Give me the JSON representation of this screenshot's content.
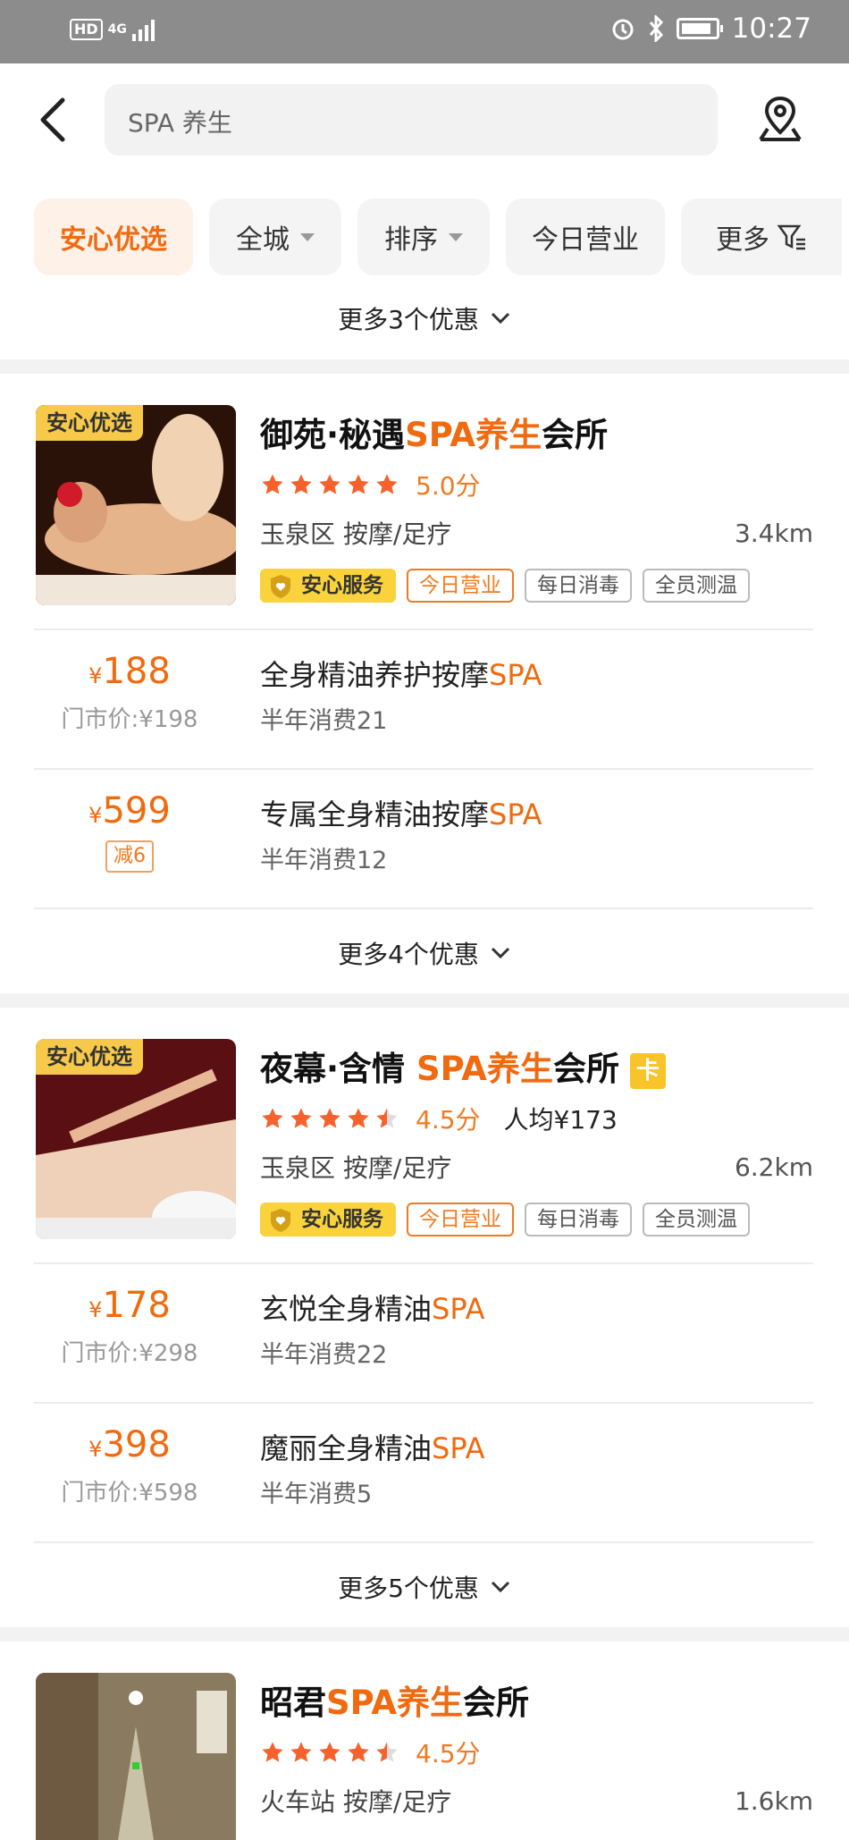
{
  "status_bar": {
    "network": "4G",
    "hd": "HD",
    "time": "10:27"
  },
  "search": {
    "value": "SPA 养生"
  },
  "filters": [
    {
      "label": "安心优选",
      "active": true
    },
    {
      "label": "全城"
    },
    {
      "label": "排序"
    },
    {
      "label": "今日营业"
    },
    {
      "label": "更多"
    }
  ],
  "more_offers_top": "更多3个优惠",
  "shops": [
    {
      "badge": "安心优选",
      "name_pre": "御苑·秘遇",
      "name_hl": "SPA养生",
      "name_post": "会所",
      "rating": 5.0,
      "score": "5.0分",
      "area": "玉泉区 按摩/足疗",
      "distance": "3.4km",
      "tags": [
        "安心服务",
        "今日营业",
        "每日消毒",
        "全员测温"
      ],
      "deals": [
        {
          "price": "188",
          "orig": "门市价:¥198",
          "title": "全身精油养护按摩",
          "title_hl": "SPA",
          "sold": "半年消费21"
        },
        {
          "price": "599",
          "minus": "减6",
          "title": "专属全身精油按摩",
          "title_hl": "SPA",
          "sold": "半年消费12"
        }
      ],
      "more": "更多4个优惠"
    },
    {
      "badge": "安心优选",
      "name_pre": "夜幕·含情 ",
      "name_hl": "SPA养生",
      "name_post": "会所",
      "card": "卡",
      "rating": 4.5,
      "score": "4.5分",
      "avg": "人均¥173",
      "area": "玉泉区 按摩/足疗",
      "distance": "6.2km",
      "tags": [
        "安心服务",
        "今日营业",
        "每日消毒",
        "全员测温"
      ],
      "deals": [
        {
          "price": "178",
          "orig": "门市价:¥298",
          "title": "玄悦全身精油",
          "title_hl": "SPA",
          "sold": "半年消费22"
        },
        {
          "price": "398",
          "orig": "门市价:¥598",
          "title": "魔丽全身精油",
          "title_hl": "SPA",
          "sold": "半年消费5"
        }
      ],
      "more": "更多5个优惠"
    },
    {
      "name_pre": "昭君",
      "name_hl": "SPA养生",
      "name_post": "会所",
      "rating": 4.5,
      "score": "4.5分",
      "area": "火车站 按摩/足疗",
      "distance": "1.6km"
    }
  ],
  "colors": {
    "accent": "#f06a10",
    "gold": "#f9d23c",
    "star": "#f5622d"
  }
}
